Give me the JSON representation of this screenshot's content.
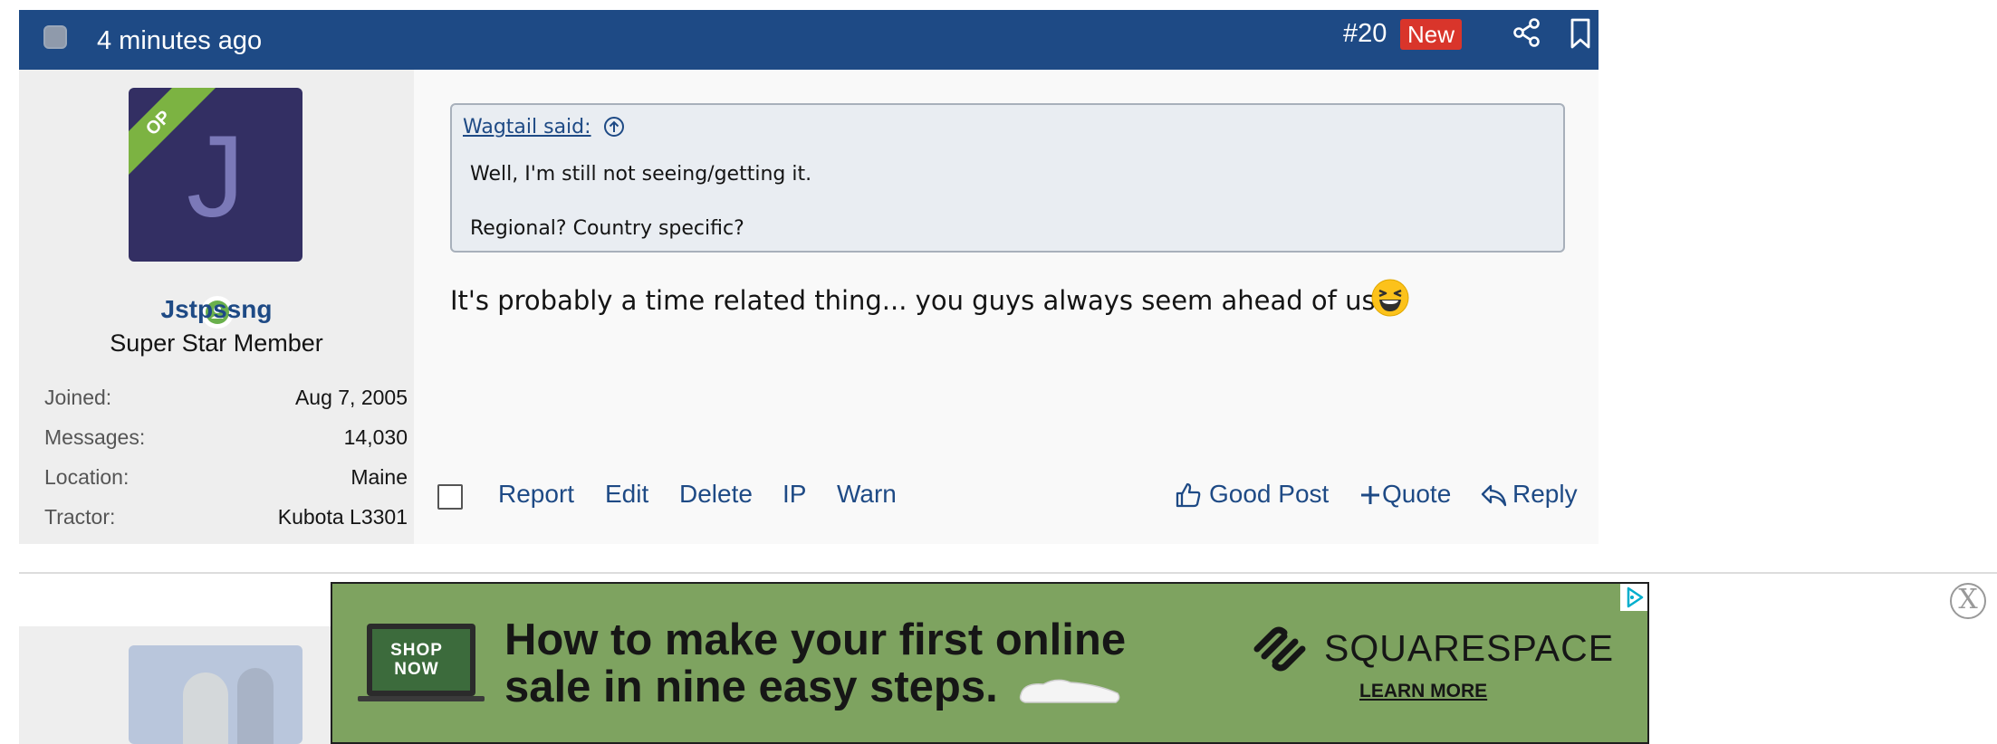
{
  "post": {
    "time": "4 minutes ago",
    "number": "#20",
    "new_badge": "New",
    "colors": {
      "header": "#1e4a85",
      "new_badge": "#d9352b",
      "link": "#1e4a85",
      "op_ribbon": "#7cb342"
    }
  },
  "user": {
    "avatar_letter": "J",
    "op_label": "OP",
    "username": "Jstpssng",
    "title": "Super Star Member",
    "stats": [
      {
        "label": "Joined:",
        "value": "Aug 7, 2005"
      },
      {
        "label": "Messages:",
        "value": "14,030"
      },
      {
        "label": "Location:",
        "value": "Maine"
      },
      {
        "label": "Tractor:",
        "value": "Kubota L3301"
      }
    ]
  },
  "quote": {
    "author": "Wagtail said:",
    "lines": [
      "Well, I'm still not seeing/getting it.",
      "Regional? Country specific?"
    ]
  },
  "message": "It's probably a time related thing... you guys always seem ahead of us!",
  "emoji": "laughing-emoji",
  "footer": {
    "left_links": [
      "Report",
      "Edit",
      "Delete",
      "IP",
      "Warn"
    ],
    "good_post": "Good Post",
    "quote": "Quote",
    "reply": "Reply"
  },
  "ad": {
    "shop_now": "SHOP NOW",
    "headline_1": "How to make your first online",
    "headline_2": "sale in nine easy steps.",
    "brand": "SQUARESPACE",
    "cta": "LEARN MORE",
    "close": "X",
    "background": "#7ea360"
  }
}
